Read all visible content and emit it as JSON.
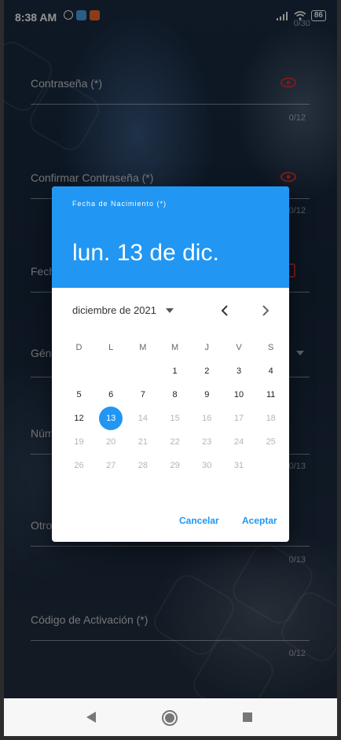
{
  "status_bar": {
    "time": "8:38 AM",
    "battery": "86"
  },
  "form": {
    "top_counter": "0/30",
    "password_label": "Contraseña (*)",
    "password_counter": "0/12",
    "confirm_label": "Confirmar Contraseña (*)",
    "confirm_counter": "0/12",
    "birth_label_partial": "Fech",
    "gender_label_partial": "Gén",
    "number_label_partial": "Núm",
    "number_counter": "0/13",
    "other_label_partial": "Otro",
    "other_counter": "0/13",
    "activation_label": "Código de Activación (*)",
    "activation_counter": "0/12"
  },
  "dialog": {
    "help_text": "Fecha de Nacimiento (*)",
    "selected_date": "lun. 13 de dic.",
    "month_year": "diciembre de 2021",
    "weekdays": [
      "D",
      "L",
      "M",
      "M",
      "J",
      "V",
      "S"
    ],
    "weeks": [
      [
        "",
        "",
        "",
        "1",
        "2",
        "3",
        "4"
      ],
      [
        "5",
        "6",
        "7",
        "8",
        "9",
        "10",
        "11"
      ],
      [
        "12",
        "13",
        "14",
        "15",
        "16",
        "17",
        "18"
      ],
      [
        "19",
        "20",
        "21",
        "22",
        "23",
        "24",
        "25"
      ],
      [
        "26",
        "27",
        "28",
        "29",
        "30",
        "31",
        ""
      ]
    ],
    "selected_day": "13",
    "cancel_label": "Cancelar",
    "ok_label": "Aceptar"
  },
  "colors": {
    "accent": "#2196f3",
    "error": "#d32f2f"
  }
}
